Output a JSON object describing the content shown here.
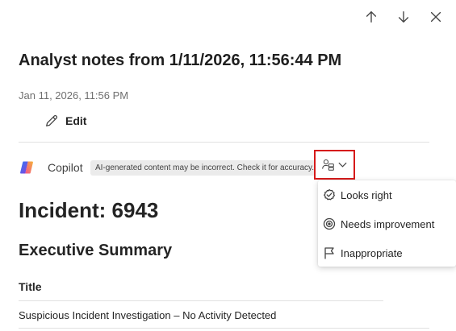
{
  "header": {
    "title": "Analyst notes from 1/11/2026, 11:56:44 PM",
    "timestamp": "Jan 11, 2026, 11:56 PM",
    "edit_label": "Edit"
  },
  "copilot": {
    "label": "Copilot",
    "disclaimer": "AI-generated content may be incorrect. Check it for accuracy."
  },
  "feedback_menu": {
    "items": [
      {
        "label": "Looks right",
        "icon": "check-circle-icon"
      },
      {
        "label": "Needs improvement",
        "icon": "target-icon"
      },
      {
        "label": "Inappropriate",
        "icon": "flag-icon"
      }
    ]
  },
  "content": {
    "incident_heading": "Incident: 6943",
    "summary_heading": "Executive Summary",
    "title_label": "Title",
    "title_value": "Suspicious Incident Investigation – No Activity Detected"
  },
  "colors": {
    "highlight_border": "#d61a1a",
    "divider": "#e1e1e1"
  }
}
